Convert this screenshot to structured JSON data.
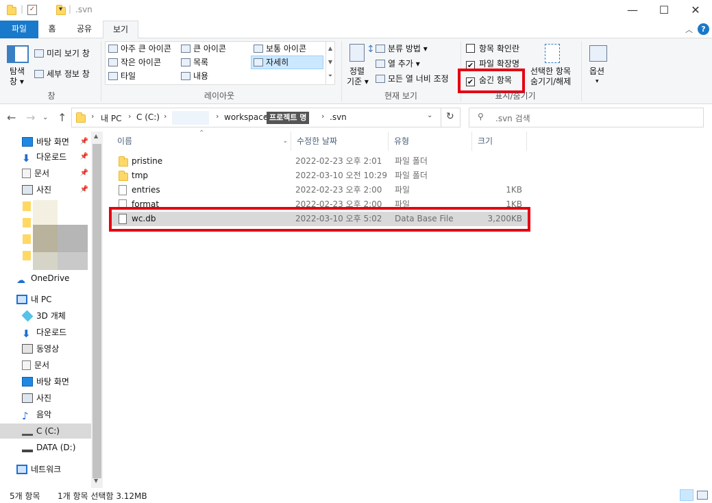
{
  "window": {
    "title": ".svn",
    "minimize": "—",
    "maximize": "☐",
    "close": "✕"
  },
  "tabs": [
    "파일",
    "홈",
    "공유",
    "보기"
  ],
  "ribbon": {
    "pane_group": {
      "nav_pane": "탐색",
      "nav_pane2": "창 ▾",
      "preview": "미리 보기 창",
      "details": "세부 정보 창",
      "label": "창"
    },
    "layout_group": {
      "items": [
        "아주 큰 아이콘",
        "큰 아이콘",
        "보통 아이콘",
        "작은 아이콘",
        "목록",
        "자세히",
        "타일",
        "내용"
      ],
      "label": "레이아웃"
    },
    "current_view_group": {
      "sort": "정렬",
      "sort2": "기준 ▾",
      "group_by": "분류 방법 ▾",
      "add_col": "열 추가 ▾",
      "fit_cols": "모든 열 너비 조정",
      "label": "현재 보기"
    },
    "show_hide_group": {
      "item_checkboxes": "항목 확인란",
      "file_extensions": "파일 확장명",
      "hidden_items": "숨긴 항목",
      "hide_selected": "선택한 항목",
      "hide_selected2": "숨기기/해제",
      "label": "표시/숨기기",
      "checks": {
        "item_checkboxes": false,
        "file_extensions": true,
        "hidden_items": true
      }
    },
    "options": "옵션"
  },
  "address": {
    "crumbs": [
      "내 PC",
      "C (C:)",
      "",
      "workspace",
      "프로젝트 명",
      ".svn"
    ],
    "search_placeholder": ".svn 검색"
  },
  "nav": {
    "quick": [
      {
        "label": "바탕 화면",
        "icon": "desktop-icon"
      },
      {
        "label": "다운로드",
        "icon": "download-icon"
      },
      {
        "label": "문서",
        "icon": "document-icon"
      },
      {
        "label": "사진",
        "icon": "pictures-icon"
      }
    ],
    "onedrive": "OneDrive",
    "pc": "내 PC",
    "pc_items": [
      "3D 개체",
      "다운로드",
      "동영상",
      "문서",
      "바탕 화면",
      "사진",
      "음악",
      "C (C:)",
      "DATA (D:)"
    ],
    "network": "네트워크"
  },
  "columns": [
    "이름",
    "수정한 날짜",
    "유형",
    "크기"
  ],
  "files": [
    {
      "name": "pristine",
      "date": "2022-02-23 오후 2:01",
      "type": "파일 폴더",
      "size": "",
      "kind": "folder"
    },
    {
      "name": "tmp",
      "date": "2022-03-10 오전 10:29",
      "type": "파일 폴더",
      "size": "",
      "kind": "folder"
    },
    {
      "name": "entries",
      "date": "2022-02-23 오후 2:00",
      "type": "파일",
      "size": "1KB",
      "kind": "file"
    },
    {
      "name": "format",
      "date": "2022-02-23 오후 2:00",
      "type": "파일",
      "size": "1KB",
      "kind": "file"
    },
    {
      "name": "wc.db",
      "date": "2022-03-10 오후 5:02",
      "type": "Data Base File",
      "size": "3,200KB",
      "kind": "db"
    }
  ],
  "status": {
    "count": "5개 항목",
    "selected": "1개 항목 선택함 3.12MB"
  },
  "colors": {
    "accent": "#1979ca",
    "highlight": "#e50012",
    "selection": "#d9d9d9"
  }
}
